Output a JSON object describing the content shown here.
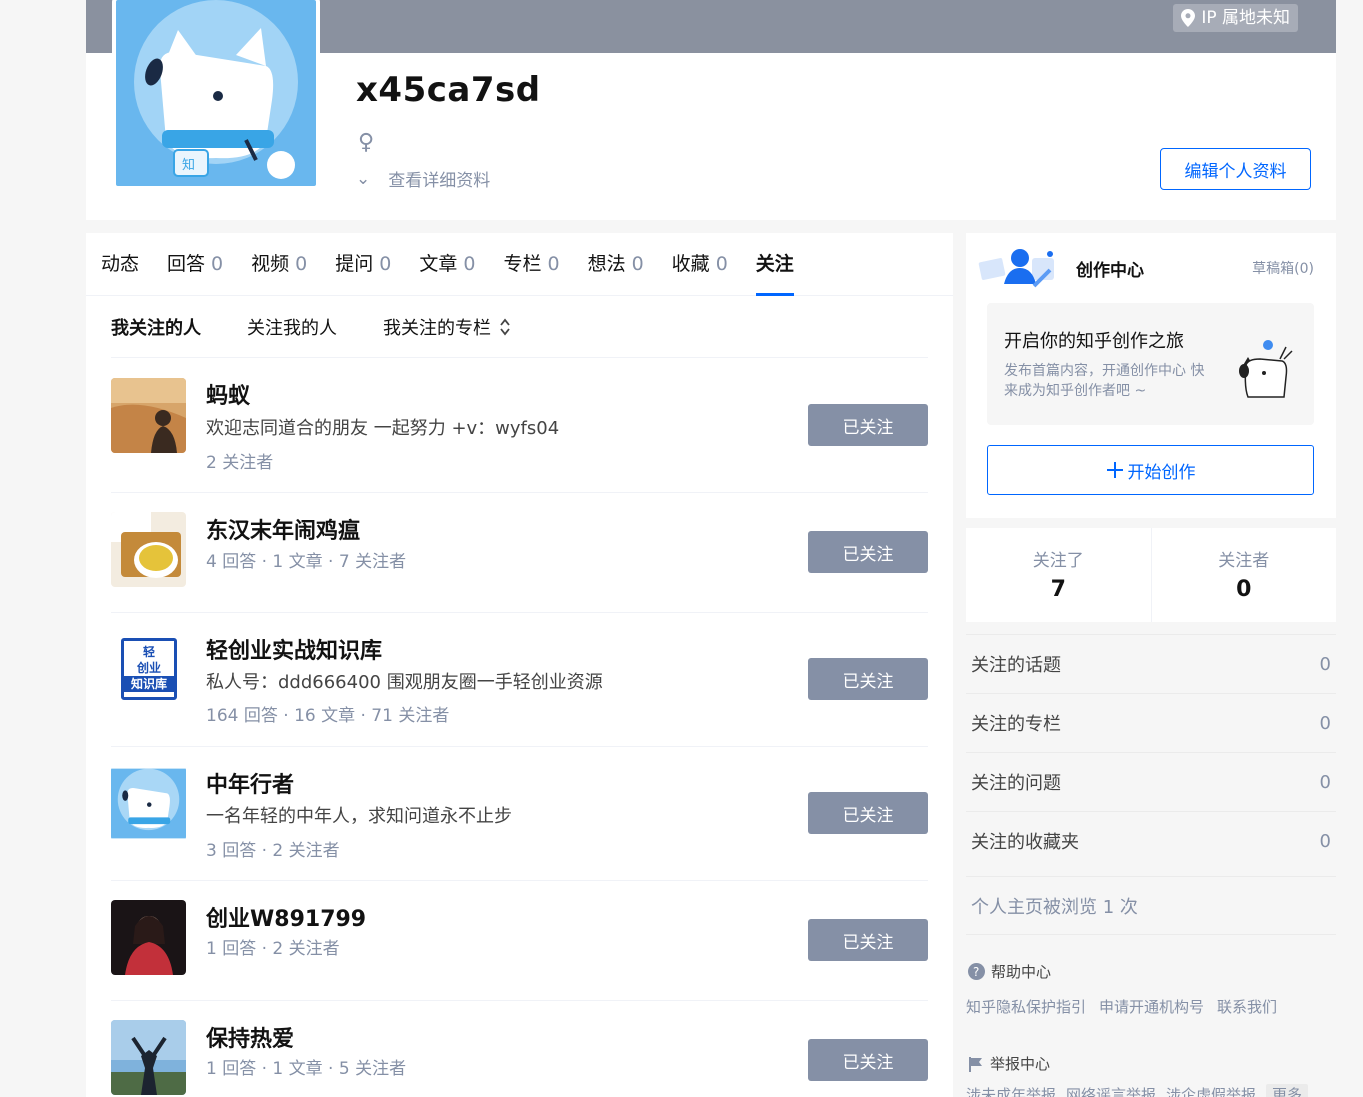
{
  "header": {
    "ip_label": "IP 属地未知",
    "username": "x45ca7sd",
    "gender_symbol": "♀",
    "detail_chevron": "⌄",
    "detail_link": "查看详细资料",
    "edit_button": "编辑个人资料"
  },
  "tabs": [
    {
      "label": "动态",
      "count": ""
    },
    {
      "label": "回答",
      "count": "0"
    },
    {
      "label": "视频",
      "count": "0"
    },
    {
      "label": "提问",
      "count": "0"
    },
    {
      "label": "文章",
      "count": "0"
    },
    {
      "label": "专栏",
      "count": "0"
    },
    {
      "label": "想法",
      "count": "0"
    },
    {
      "label": "收藏",
      "count": "0"
    },
    {
      "label": "关注",
      "count": ""
    }
  ],
  "subtabs": {
    "following_people": "我关注的人",
    "followers": "关注我的人",
    "following_columns": "我关注的专栏"
  },
  "following": [
    {
      "name": "蚂蚁",
      "bio": "欢迎志同道合的朋友 一起努力 +v：wyfs04",
      "meta": "2 关注者",
      "button": "已关注"
    },
    {
      "name": "东汉末年闹鸡瘟",
      "bio": "",
      "meta": "4 回答 · 1 文章 · 7 关注者",
      "button": "已关注"
    },
    {
      "name": "轻创业实战知识库",
      "bio": "私人号：ddd666400 围观朋友圈一手轻创业资源",
      "meta": "164 回答 · 16 文章 · 71 关注者",
      "button": "已关注",
      "avatar_text": [
        "轻",
        "创业",
        "知识库"
      ]
    },
    {
      "name": "中年行者",
      "bio": "一名年轻的中年人，求知问道永不止步",
      "meta": "3 回答 · 2 关注者",
      "button": "已关注"
    },
    {
      "name": "创业W891799",
      "bio": "",
      "meta": "1 回答 · 2 关注者",
      "button": "已关注"
    },
    {
      "name": "保持热爱",
      "bio": "",
      "meta": "1 回答 · 1 文章 · 5 关注者",
      "button": "已关注"
    }
  ],
  "creator": {
    "title": "创作中心",
    "drafts": "草稿箱(0)",
    "headline": "开启你的知乎创作之旅",
    "desc": "发布首篇内容，开通创作中心 快来成为知乎创作者吧 ~",
    "start_button": "开始创作"
  },
  "counts": {
    "following_label": "关注了",
    "following_value": "7",
    "followers_label": "关注者",
    "followers_value": "0"
  },
  "follow_list": [
    {
      "label": "关注的话题",
      "value": "0"
    },
    {
      "label": "关注的专栏",
      "value": "0"
    },
    {
      "label": "关注的问题",
      "value": "0"
    },
    {
      "label": "关注的收藏夹",
      "value": "0"
    }
  ],
  "views": "个人主页被浏览 1 次",
  "help": {
    "title": "帮助中心",
    "links": [
      "知乎隐私保护指引",
      "申请开通机构号",
      "联系我们"
    ]
  },
  "report": {
    "title": "举报中心",
    "links": [
      "涉未成年举报",
      "网络谣言举报",
      "涉企虚假举报"
    ],
    "more": "更多"
  },
  "colors": {
    "brand": "#0066ff",
    "cover": "#8a919f",
    "followed_button": "#8590a6"
  }
}
